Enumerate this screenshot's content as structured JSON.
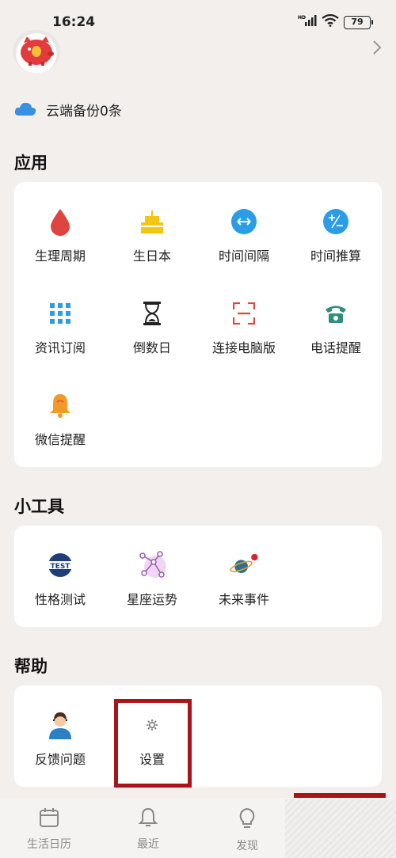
{
  "status_bar": {
    "time": "16:24",
    "battery": "79"
  },
  "cloud_backup": {
    "label": "云端备份0条",
    "icon": "cloud-icon"
  },
  "apps": {
    "title": "应用",
    "items": [
      {
        "label": "生理周期",
        "icon": "blood-drop-icon"
      },
      {
        "label": "生日本",
        "icon": "birthday-cake-icon"
      },
      {
        "label": "时间间隔",
        "icon": "interval-arrows-icon"
      },
      {
        "label": "时间推算",
        "icon": "plus-minus-icon"
      },
      {
        "label": "资讯订阅",
        "icon": "grid-dots-icon"
      },
      {
        "label": "倒数日",
        "icon": "hourglass-icon"
      },
      {
        "label": "连接电脑版",
        "icon": "scan-frame-icon"
      },
      {
        "label": "电话提醒",
        "icon": "telephone-icon"
      },
      {
        "label": "微信提醒",
        "icon": "bell-icon"
      }
    ]
  },
  "tools": {
    "title": "小工具",
    "items": [
      {
        "label": "性格测试",
        "icon": "test-badge-icon"
      },
      {
        "label": "星座运势",
        "icon": "constellation-icon"
      },
      {
        "label": "未来事件",
        "icon": "planet-icon"
      }
    ]
  },
  "help": {
    "title": "帮助",
    "items": [
      {
        "label": "反馈问题",
        "icon": "customer-service-icon"
      },
      {
        "label": "设置",
        "icon": "gear-icon"
      }
    ]
  },
  "bottom_nav": [
    {
      "label": "生活日历",
      "icon": "calendar-icon"
    },
    {
      "label": "最近",
      "icon": "bell-icon"
    },
    {
      "label": "发现",
      "icon": "lightbulb-icon"
    }
  ],
  "colors": {
    "highlight": "#a8141a",
    "cloud": "#3a8fe0",
    "drop": "#e0443e",
    "blue": "#2b9de6"
  }
}
